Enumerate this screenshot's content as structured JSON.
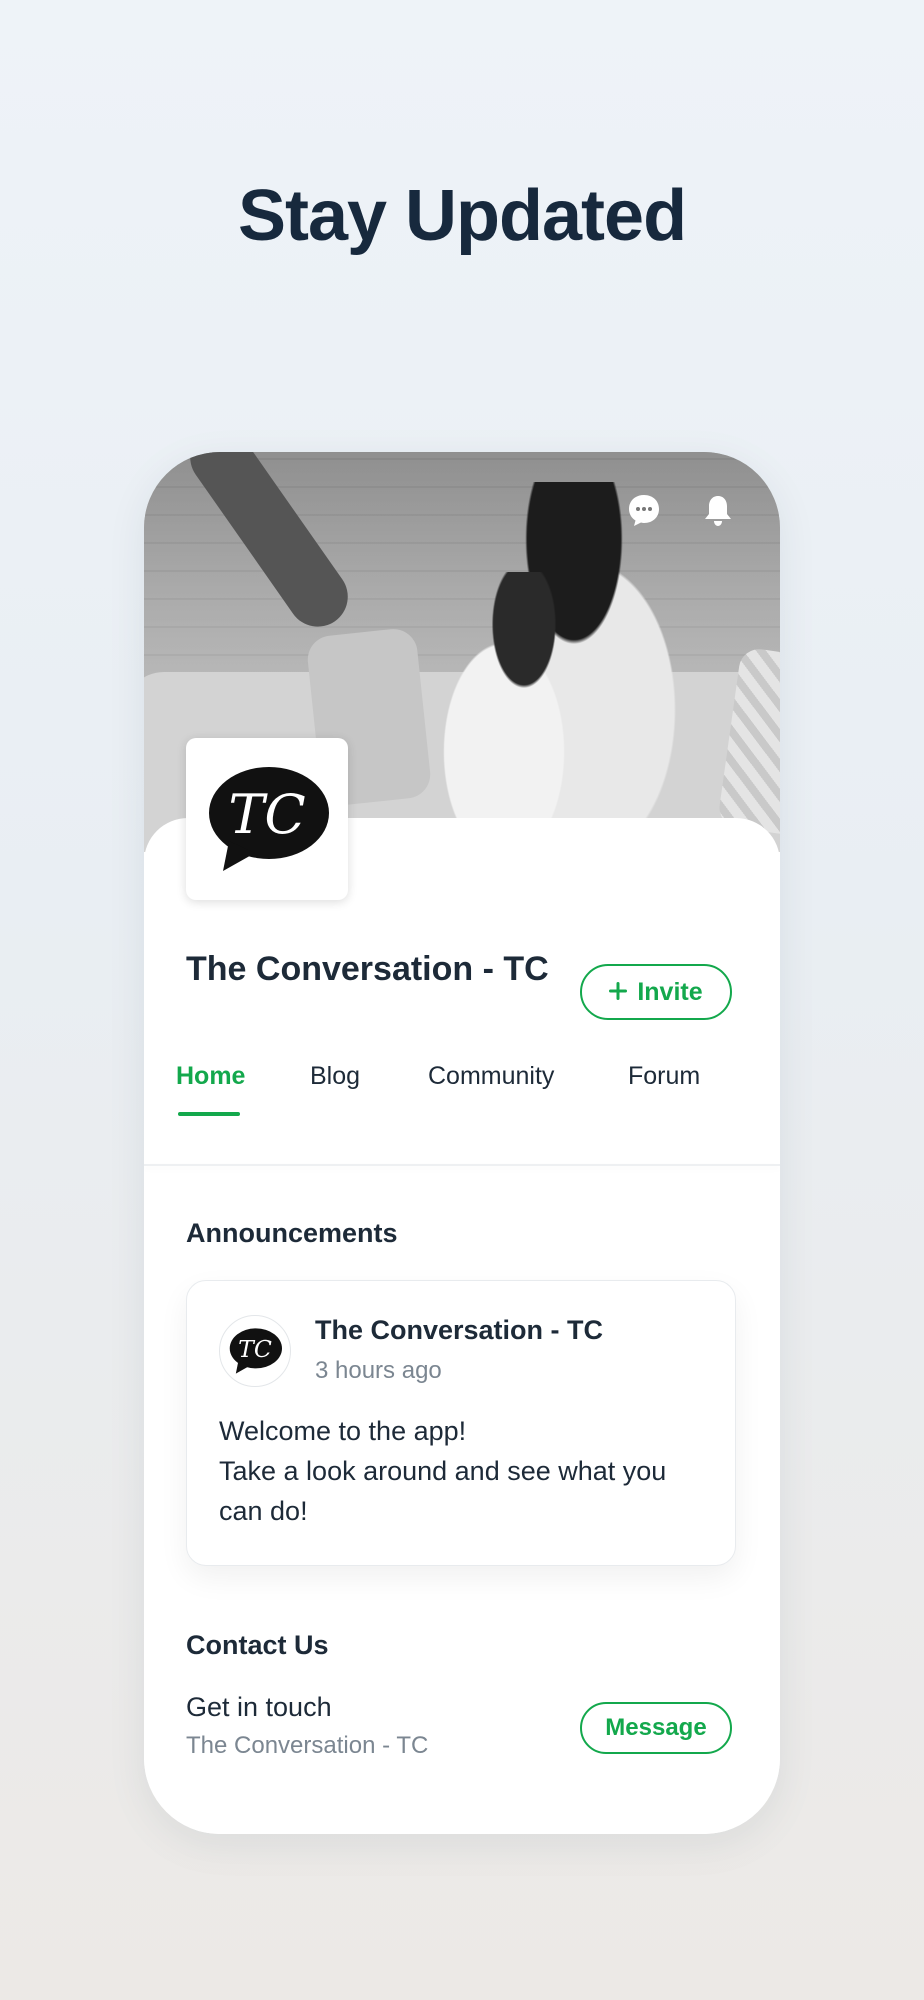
{
  "headline": "Stay Updated",
  "colors": {
    "accent": "#13a84c",
    "text": "#1d2a38",
    "muted": "#7b8691"
  },
  "cover": {
    "icons": [
      "chat-icon",
      "bell-icon"
    ]
  },
  "profile": {
    "logo_text": "TC",
    "name": "The Conversation - TC",
    "invite_label": "Invite"
  },
  "tabs": [
    {
      "label": "Home",
      "active": true
    },
    {
      "label": "Blog",
      "active": false
    },
    {
      "label": "Community",
      "active": false
    },
    {
      "label": "Forum",
      "active": false
    }
  ],
  "announcements": {
    "title": "Announcements",
    "post": {
      "author": "The Conversation - TC",
      "time": "3 hours ago",
      "body_lines": [
        "Welcome to the app!",
        "Take a look around and see what you",
        "can do!"
      ]
    }
  },
  "contact": {
    "title": "Contact Us",
    "line1": "Get in touch",
    "line2": "The Conversation - TC",
    "message_label": "Message"
  }
}
